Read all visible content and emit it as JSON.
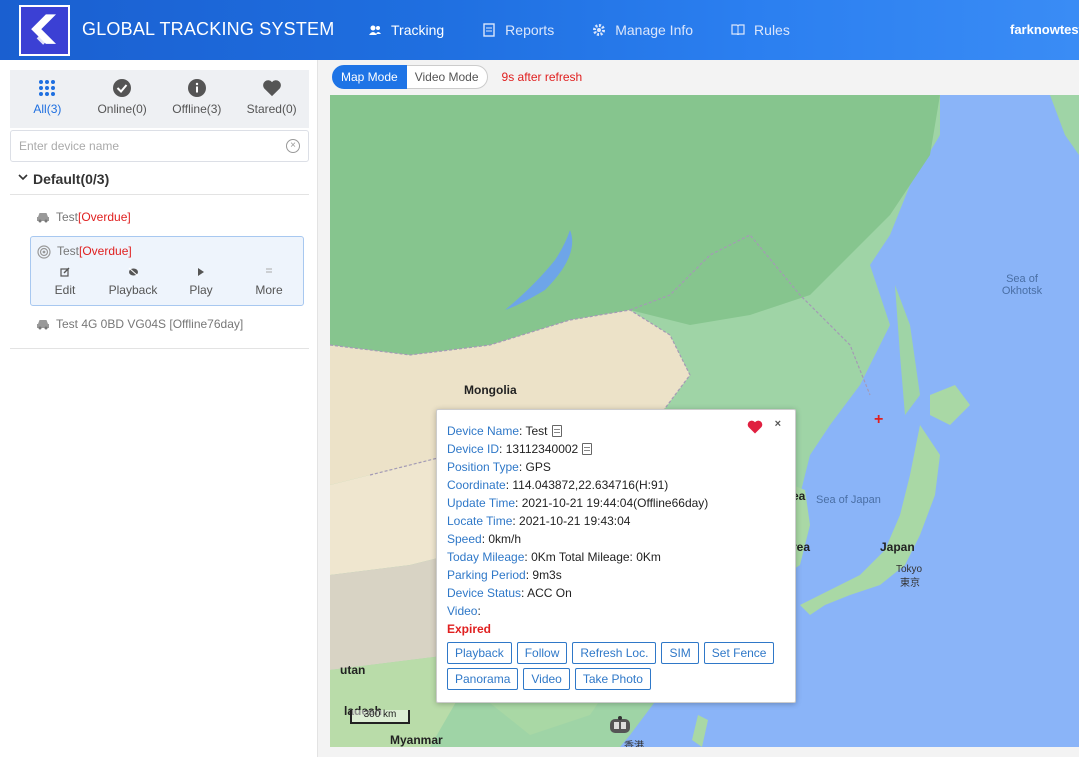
{
  "header": {
    "app_title": "GLOBAL TRACKING SYSTEM",
    "nav": [
      {
        "label": "Tracking",
        "icon": "users-icon",
        "active": true
      },
      {
        "label": "Reports",
        "icon": "report-icon",
        "active": false
      },
      {
        "label": "Manage Info",
        "icon": "gear-icon",
        "active": false
      },
      {
        "label": "Rules",
        "icon": "book-icon",
        "active": false
      }
    ],
    "user": "farknowtest"
  },
  "sidebar": {
    "filters": [
      {
        "label": "All(3)",
        "icon": "grid-icon",
        "active": true
      },
      {
        "label": "Online(0)",
        "icon": "check-circle-icon",
        "active": false
      },
      {
        "label": "Offline(3)",
        "icon": "info-circle-icon",
        "active": false
      },
      {
        "label": "Stared(0)",
        "icon": "heart-icon",
        "active": false
      }
    ],
    "search_placeholder": "Enter device name",
    "group_label": "Default(0/3)",
    "devices": [
      {
        "name": "Test ",
        "status": "[Overdue]",
        "icon": "car-icon"
      },
      {
        "name": "Test ",
        "status": "[Overdue]",
        "icon": "signal-icon",
        "selected": true
      },
      {
        "name": "Test 4G 0BD VG04S [Offline76day]",
        "status": "",
        "icon": "car-icon"
      }
    ],
    "actions": [
      {
        "label": "Edit",
        "icon": "edit-icon"
      },
      {
        "label": "Playback",
        "icon": "playback-icon"
      },
      {
        "label": "Play",
        "icon": "play-icon"
      },
      {
        "label": "More",
        "icon": "more-icon"
      }
    ]
  },
  "map": {
    "modes": [
      "Map Mode",
      "Video Mode"
    ],
    "refresh_note": "9s after refresh",
    "labels": {
      "mongolia": "Mongolia",
      "sea_okhotsk": "Sea of Okhotsk",
      "sea_japan": "Sea of Japan",
      "japan": "Japan",
      "tokyo": "Tokyo",
      "tokyo_cjk": "東京",
      "korea_n": "ea",
      "korea_s": "rea",
      "bhutan": "utan",
      "bangladesh": "ladesh",
      "myanmar": "Myanmar",
      "hongkong": "香港"
    },
    "scale": "300 km"
  },
  "popup": {
    "rows": [
      {
        "label": "Device Name",
        "value": "Test",
        "copy": true
      },
      {
        "label": "Device ID",
        "value": "13112340002",
        "copy": true
      },
      {
        "label": "Position Type",
        "value": "GPS"
      },
      {
        "label": "Coordinate",
        "value": "114.043872,22.634716(H:91)"
      },
      {
        "label": "Update Time",
        "value": "2021-10-21 19:44:04(Offline66day)"
      },
      {
        "label": "Locate Time",
        "value": "2021-10-21 19:43:04"
      },
      {
        "label": "Speed",
        "value": "0km/h"
      },
      {
        "label": "Today Mileage",
        "value": "0Km Total Mileage: 0Km"
      },
      {
        "label": "Parking Period",
        "value": "9m3s"
      },
      {
        "label": "Device Status",
        "value": "ACC On"
      },
      {
        "label": "Video",
        "value": ""
      }
    ],
    "expired": "Expired",
    "buttons_row1": [
      "Playback",
      "Follow",
      "Refresh Loc.",
      "SIM",
      "Set Fence"
    ],
    "buttons_row2": [
      "Panorama",
      "Video",
      "Take Photo"
    ],
    "close": "×"
  }
}
